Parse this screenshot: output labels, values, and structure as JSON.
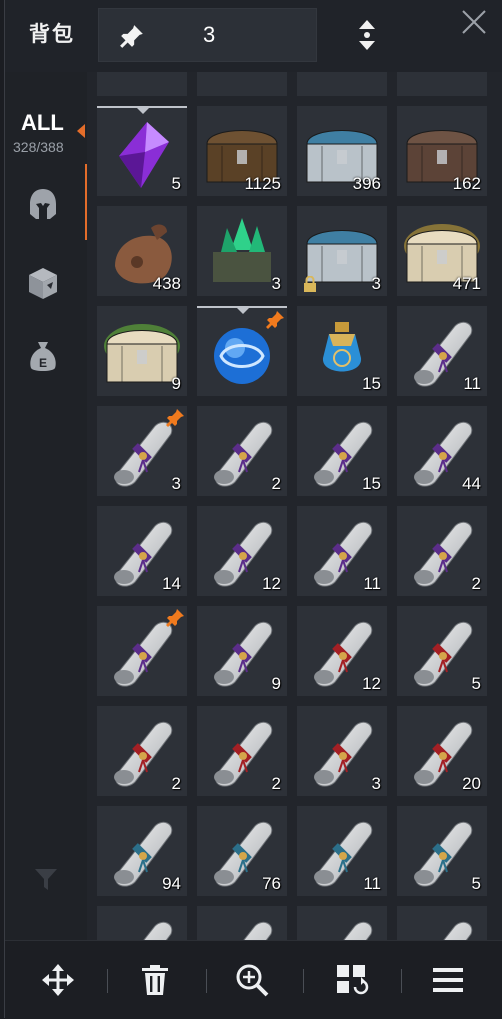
{
  "header": {
    "title": "背包",
    "pinned_count": "3"
  },
  "sidebar": {
    "all_label": "ALL",
    "capacity": "328/388",
    "categories": [
      {
        "icon": "helmet-icon"
      },
      {
        "icon": "box-icon"
      },
      {
        "icon": "money-bag-icon",
        "letter": "E"
      }
    ]
  },
  "items": [
    {
      "kind": "crystal-purple",
      "qty": "5",
      "selected": true
    },
    {
      "kind": "chest-wood",
      "qty": "1125"
    },
    {
      "kind": "chest-silver",
      "qty": "396"
    },
    {
      "kind": "chest-iron",
      "qty": "162"
    },
    {
      "kind": "pouch",
      "qty": "438"
    },
    {
      "kind": "crystal-green-crate",
      "qty": "3"
    },
    {
      "kind": "chest-silver",
      "qty": "3",
      "locked": true
    },
    {
      "kind": "chest-gold-glow",
      "qty": "471"
    },
    {
      "kind": "chest-green-glow",
      "qty": "9"
    },
    {
      "kind": "orb-blue",
      "qty": "",
      "pinned": true,
      "selected": true
    },
    {
      "kind": "potion-blue",
      "qty": "15"
    },
    {
      "kind": "scroll-purple",
      "qty": "11"
    },
    {
      "kind": "scroll-purple",
      "qty": "3",
      "pinned": true
    },
    {
      "kind": "scroll-purple",
      "qty": "2"
    },
    {
      "kind": "scroll-purple",
      "qty": "15"
    },
    {
      "kind": "scroll-purple",
      "qty": "44"
    },
    {
      "kind": "scroll-purple",
      "qty": "14"
    },
    {
      "kind": "scroll-purple",
      "qty": "12"
    },
    {
      "kind": "scroll-purple",
      "qty": "11"
    },
    {
      "kind": "scroll-purple",
      "qty": "2"
    },
    {
      "kind": "scroll-purple",
      "qty": "",
      "pinned": true
    },
    {
      "kind": "scroll-purple",
      "qty": "9"
    },
    {
      "kind": "scroll-red",
      "qty": "12"
    },
    {
      "kind": "scroll-red",
      "qty": "5"
    },
    {
      "kind": "scroll-red",
      "qty": "2"
    },
    {
      "kind": "scroll-red",
      "qty": "2"
    },
    {
      "kind": "scroll-red",
      "qty": "3"
    },
    {
      "kind": "scroll-red",
      "qty": "20"
    },
    {
      "kind": "scroll-teal",
      "qty": "94"
    },
    {
      "kind": "scroll-teal",
      "qty": "76"
    },
    {
      "kind": "scroll-teal",
      "qty": "11"
    },
    {
      "kind": "scroll-teal",
      "qty": "5"
    },
    {
      "kind": "scroll-teal",
      "qty": ""
    },
    {
      "kind": "scroll-teal",
      "qty": ""
    },
    {
      "kind": "scroll-teal",
      "qty": ""
    },
    {
      "kind": "scroll-teal",
      "qty": ""
    }
  ],
  "toolbar": [
    {
      "icon": "move-arrows-icon"
    },
    {
      "icon": "trash-icon"
    },
    {
      "icon": "zoom-in-icon"
    },
    {
      "icon": "grid-refresh-icon"
    },
    {
      "icon": "menu-icon"
    }
  ],
  "colors": {
    "accent": "#e46d2a",
    "panel": "#22252b",
    "slot": "#2d3138"
  }
}
